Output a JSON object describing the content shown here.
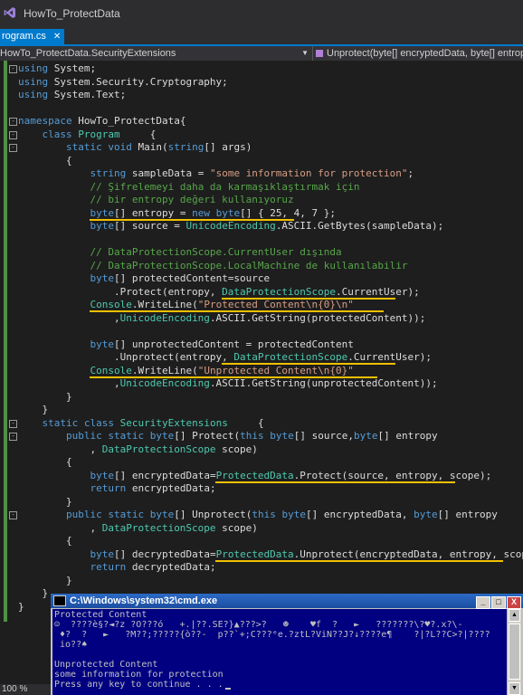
{
  "window": {
    "title": "HowTo_ProtectData"
  },
  "tabs": [
    {
      "label": "rogram.cs",
      "close": "✕"
    }
  ],
  "nav": {
    "left": "HowTo_ProtectData.SecurityExtensions",
    "right": "Unprotect(byte[] encryptedData, byte[] entropy, D"
  },
  "code_lines": [
    {
      "segs": [
        {
          "c": "kw",
          "t": "using"
        },
        {
          "t": " System;"
        }
      ]
    },
    {
      "segs": [
        {
          "c": "kw",
          "t": "using"
        },
        {
          "t": " System.Security.Cryptography;"
        }
      ]
    },
    {
      "segs": [
        {
          "c": "kw",
          "t": "using"
        },
        {
          "t": " System.Text;"
        }
      ]
    },
    {
      "segs": []
    },
    {
      "segs": [
        {
          "c": "kw",
          "t": "namespace"
        },
        {
          "t": " HowTo_ProtectData{"
        }
      ]
    },
    {
      "segs": [
        {
          "t": "    "
        },
        {
          "c": "kw",
          "t": "class"
        },
        {
          "t": " "
        },
        {
          "c": "ty",
          "t": "Program"
        },
        {
          "t": "     {"
        }
      ]
    },
    {
      "segs": [
        {
          "t": "        "
        },
        {
          "c": "kw",
          "t": "static"
        },
        {
          "t": " "
        },
        {
          "c": "kw",
          "t": "void"
        },
        {
          "t": " Main("
        },
        {
          "c": "kw",
          "t": "string"
        },
        {
          "t": "[] args)"
        }
      ]
    },
    {
      "segs": [
        {
          "t": "        {"
        }
      ]
    },
    {
      "segs": [
        {
          "t": "            "
        },
        {
          "c": "kw",
          "t": "string"
        },
        {
          "t": " sampleData = "
        },
        {
          "c": "st",
          "t": "\"some information for protection\""
        },
        {
          "t": ";"
        }
      ]
    },
    {
      "segs": [
        {
          "t": "            "
        },
        {
          "c": "cm",
          "t": "// Şifrelemeyi daha da karmaşıklaştırmak için"
        }
      ]
    },
    {
      "segs": [
        {
          "t": "            "
        },
        {
          "c": "cm",
          "t": "// bir entropy değeri kullanıyoruz"
        }
      ]
    },
    {
      "segs": [
        {
          "t": "            "
        },
        {
          "c": "kw",
          "t": "byte"
        },
        {
          "t": "[] entropy = "
        },
        {
          "c": "kw",
          "t": "new"
        },
        {
          "t": " "
        },
        {
          "c": "kw",
          "t": "byte"
        },
        {
          "t": "[] { 25, 4, 7 };"
        }
      ]
    },
    {
      "segs": [
        {
          "t": "            "
        },
        {
          "c": "kw",
          "t": "byte"
        },
        {
          "t": "[] source = "
        },
        {
          "c": "ty",
          "t": "UnicodeEncoding"
        },
        {
          "t": ".ASCII.GetBytes(sampleData);"
        }
      ]
    },
    {
      "segs": []
    },
    {
      "segs": [
        {
          "t": "            "
        },
        {
          "c": "cm",
          "t": "// DataProtectionScope.CurrentUser dışında"
        }
      ]
    },
    {
      "segs": [
        {
          "t": "            "
        },
        {
          "c": "cm",
          "t": "// DataProtectionScope.LocalMachine de kullanılabilir"
        }
      ]
    },
    {
      "segs": [
        {
          "t": "            "
        },
        {
          "c": "kw",
          "t": "byte"
        },
        {
          "t": "[] protectedContent=source"
        }
      ]
    },
    {
      "segs": [
        {
          "t": "                .Protect(entropy, "
        },
        {
          "c": "ty",
          "t": "DataProtectionScope"
        },
        {
          "t": ".CurrentUser);"
        }
      ]
    },
    {
      "segs": [
        {
          "t": "            "
        },
        {
          "c": "ty",
          "t": "Console"
        },
        {
          "t": ".WriteLine("
        },
        {
          "c": "st",
          "t": "\"Protected Content\\n{0}\\n\""
        }
      ]
    },
    {
      "segs": [
        {
          "t": "                ,"
        },
        {
          "c": "ty",
          "t": "UnicodeEncoding"
        },
        {
          "t": ".ASCII.GetString(protectedContent));"
        }
      ]
    },
    {
      "segs": []
    },
    {
      "segs": [
        {
          "t": "            "
        },
        {
          "c": "kw",
          "t": "byte"
        },
        {
          "t": "[] unprotectedContent = protectedContent"
        }
      ]
    },
    {
      "segs": [
        {
          "t": "                .Unprotect(entropy, "
        },
        {
          "c": "ty",
          "t": "DataProtectionScope"
        },
        {
          "t": ".CurrentUser);"
        }
      ]
    },
    {
      "segs": [
        {
          "t": "            "
        },
        {
          "c": "ty",
          "t": "Console"
        },
        {
          "t": ".WriteLine("
        },
        {
          "c": "st",
          "t": "\"Unprotected Content\\n{0}\""
        }
      ]
    },
    {
      "segs": [
        {
          "t": "                ,"
        },
        {
          "c": "ty",
          "t": "UnicodeEncoding"
        },
        {
          "t": ".ASCII.GetString(unprotectedContent));"
        }
      ]
    },
    {
      "segs": [
        {
          "t": "        }"
        }
      ]
    },
    {
      "segs": [
        {
          "t": "    }"
        }
      ]
    },
    {
      "segs": [
        {
          "t": "    "
        },
        {
          "c": "kw",
          "t": "static"
        },
        {
          "t": " "
        },
        {
          "c": "kw",
          "t": "class"
        },
        {
          "t": " "
        },
        {
          "c": "ty",
          "t": "SecurityExtensions"
        },
        {
          "t": "     {"
        }
      ]
    },
    {
      "segs": [
        {
          "t": "        "
        },
        {
          "c": "kw",
          "t": "public"
        },
        {
          "t": " "
        },
        {
          "c": "kw",
          "t": "static"
        },
        {
          "t": " "
        },
        {
          "c": "kw",
          "t": "byte"
        },
        {
          "t": "[] Protect("
        },
        {
          "c": "kw",
          "t": "this"
        },
        {
          "t": " "
        },
        {
          "c": "kw",
          "t": "byte"
        },
        {
          "t": "[] source,"
        },
        {
          "c": "kw",
          "t": "byte"
        },
        {
          "t": "[] entropy"
        }
      ]
    },
    {
      "segs": [
        {
          "t": "            , "
        },
        {
          "c": "ty",
          "t": "DataProtectionScope"
        },
        {
          "t": " scope)"
        }
      ]
    },
    {
      "segs": [
        {
          "t": "        {"
        }
      ]
    },
    {
      "segs": [
        {
          "t": "            "
        },
        {
          "c": "kw",
          "t": "byte"
        },
        {
          "t": "[] encryptedData="
        },
        {
          "c": "ty",
          "t": "ProtectedData"
        },
        {
          "t": ".Protect(source, entropy, scope);"
        }
      ]
    },
    {
      "segs": [
        {
          "t": "            "
        },
        {
          "c": "kw",
          "t": "return"
        },
        {
          "t": " encryptedData;"
        }
      ]
    },
    {
      "segs": [
        {
          "t": "        }"
        }
      ]
    },
    {
      "segs": [
        {
          "t": "        "
        },
        {
          "c": "kw",
          "t": "public"
        },
        {
          "t": " "
        },
        {
          "c": "kw",
          "t": "static"
        },
        {
          "t": " "
        },
        {
          "c": "kw",
          "t": "byte"
        },
        {
          "t": "[] Unprotect("
        },
        {
          "c": "kw",
          "t": "this"
        },
        {
          "t": " "
        },
        {
          "c": "kw",
          "t": "byte"
        },
        {
          "t": "[] encryptedData, "
        },
        {
          "c": "kw",
          "t": "byte"
        },
        {
          "t": "[] entropy"
        }
      ]
    },
    {
      "segs": [
        {
          "t": "            , "
        },
        {
          "c": "ty",
          "t": "DataProtectionScope"
        },
        {
          "t": " scope)"
        }
      ]
    },
    {
      "segs": [
        {
          "t": "        {"
        }
      ]
    },
    {
      "segs": [
        {
          "t": "            "
        },
        {
          "c": "kw",
          "t": "byte"
        },
        {
          "t": "[] decryptedData="
        },
        {
          "c": "ty",
          "t": "ProtectedData"
        },
        {
          "t": ".Unprotect(encryptedData, entropy, scope);"
        }
      ]
    },
    {
      "segs": [
        {
          "t": "            "
        },
        {
          "c": "kw",
          "t": "return"
        },
        {
          "t": " decryptedData;"
        }
      ]
    },
    {
      "segs": [
        {
          "t": "        }"
        }
      ]
    },
    {
      "segs": [
        {
          "t": "    }"
        }
      ]
    },
    {
      "segs": [
        {
          "t": "}"
        }
      ]
    }
  ],
  "cmd": {
    "title": "C:\\Windows\\system32\\cmd.exe",
    "buttons": [
      "_",
      "□",
      "X"
    ],
    "lines": [
      "Protected Content",
      "☺  ????è§?◄?z ?O???ó   +.|??.SE?}▲???>?   ☻    ♥f  ?   ►   ???????\\?♥?.x?\\-",
      " ♦?  ?   ►   ?M??;?????{ò??-  p??`+;C???ᵉe.?ztL?ViN??J?↓????e¶    ?|?L??C>?|????",
      " io??♠",
      "",
      "Unprotected Content",
      "some information for protection",
      "Press any key to continue . . ."
    ]
  },
  "status": {
    "zoom": "100 %"
  },
  "colors": {
    "accent": "#007acc",
    "highlight_underline": "#f0c000",
    "keyword": "#569cd6",
    "type": "#4ec9b0",
    "string": "#d69d85",
    "comment": "#57a64a"
  }
}
